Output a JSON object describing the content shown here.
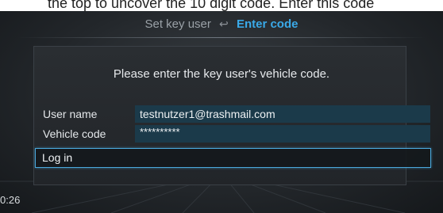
{
  "caption": "the top to uncover the 10 digit code.  Enter this code",
  "breadcrumb": {
    "parent": "Set key user",
    "separator": "↩",
    "current": "Enter code"
  },
  "instruction": "Please enter the key user's vehicle code.",
  "form": {
    "user_name_label": "User name",
    "user_name_value": "testnutzer1@trashmail.com",
    "vehicle_code_label": "Vehicle code",
    "vehicle_code_value": "**********"
  },
  "login_button": "Log in",
  "timestamp": "0:26",
  "colors": {
    "accent": "#3aa9e8",
    "field_background": "#1b3a4a",
    "screen_background": "#23272b"
  }
}
